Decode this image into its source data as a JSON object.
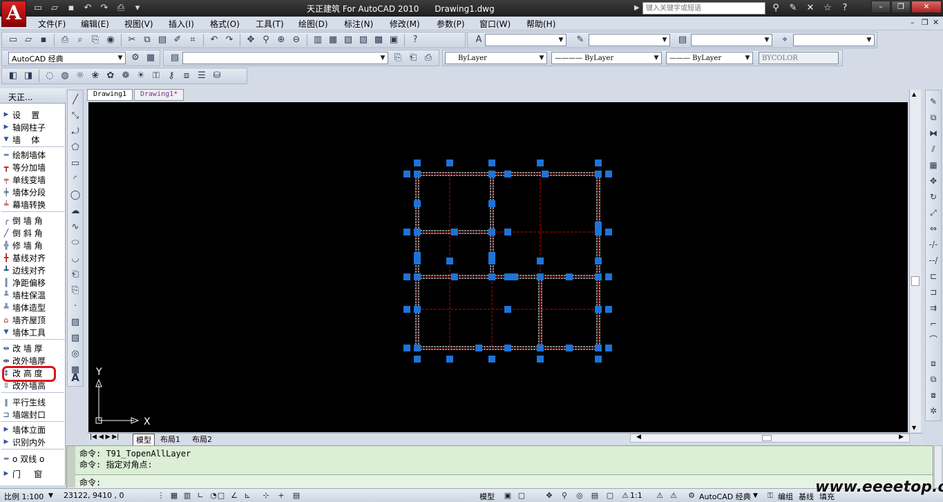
{
  "titlebar": {
    "logo": "A",
    "title": "天正建筑 For AutoCAD 2010      Drawing1.dwg",
    "search_placeholder": "键入关键字或短语",
    "window_buttons": [
      "–",
      "❐",
      "✕"
    ]
  },
  "menu": [
    "文件(F)",
    "编辑(E)",
    "视图(V)",
    "插入(I)",
    "格式(O)",
    "工具(T)",
    "绘图(D)",
    "标注(N)",
    "修改(M)",
    "参数(P)",
    "窗口(W)",
    "帮助(H)"
  ],
  "workspace": {
    "value": "AutoCAD 经典"
  },
  "properties": {
    "color": "ByLayer",
    "linetype": "———— ByLayer",
    "lineweight": "——— ByLayer",
    "plotstyle": "BYCOLOR"
  },
  "tz_panel": {
    "title": "天正...",
    "items": [
      {
        "label": "设    置",
        "icon": "tri"
      },
      {
        "label": "轴网柱子",
        "icon": "tri"
      },
      {
        "label": "墙    体",
        "icon": "tri-down"
      },
      {
        "label": "绘制墙体",
        "icon": "wall-draw-icon"
      },
      {
        "label": "等分加墙",
        "icon": "wall-divide-icon"
      },
      {
        "label": "单线变墙",
        "icon": "line-to-wall-icon"
      },
      {
        "label": "墙体分段",
        "icon": "wall-segment-icon"
      },
      {
        "label": "幕墙转换",
        "icon": "curtain-wall-icon"
      },
      {
        "label": "倒 墙 角",
        "icon": "wall-fillet-icon"
      },
      {
        "label": "倒 斜 角",
        "icon": "wall-chamfer-icon"
      },
      {
        "label": "修 墙 角",
        "icon": "wall-fix-icon"
      },
      {
        "label": "基线对齐",
        "icon": "baseline-align-icon"
      },
      {
        "label": "边线对齐",
        "icon": "edge-align-icon"
      },
      {
        "label": "净距偏移",
        "icon": "offset-icon"
      },
      {
        "label": "墙柱保温",
        "icon": "insulation-icon"
      },
      {
        "label": "墙体造型",
        "icon": "wall-shape-icon"
      },
      {
        "label": "墙齐屋顶",
        "icon": "wall-roof-icon"
      },
      {
        "label": "墙体工具",
        "icon": "tri-down"
      },
      {
        "label": "改 墙 厚",
        "icon": "thickness-icon"
      },
      {
        "label": "改外墙厚",
        "icon": "outer-thickness-icon"
      },
      {
        "label": "改 高 度",
        "icon": "height-icon"
      },
      {
        "label": "改外墙高",
        "icon": "outer-height-icon"
      },
      {
        "label": "平行生线",
        "icon": "parallel-line-icon"
      },
      {
        "label": "墙端封口",
        "icon": "end-seal-icon"
      },
      {
        "label": "墙体立面",
        "icon": "tri"
      },
      {
        "label": "识别内外",
        "icon": "tri"
      },
      {
        "label": "o 双线 o",
        "icon": "double-line-icon"
      },
      {
        "label": "门     窗",
        "icon": "tri"
      }
    ]
  },
  "tabs": [
    "Drawing1",
    "Drawing1*"
  ],
  "layout_tabs": [
    "模型",
    "布局1",
    "布局2"
  ],
  "ucs": {
    "x_label": "X",
    "y_label": "Y"
  },
  "command": {
    "history": [
      "命令: T91_TopenAllLayer",
      "命令: 指定对角点:"
    ],
    "prompt": "命令:"
  },
  "status": {
    "scale": "比例 1:100",
    "coords": "23122, 9410 , 0",
    "model": "模型",
    "annotation_scale": "1:1",
    "workspace": "AutoCAD 经典",
    "group": "编组",
    "baseline": "基线",
    "fill": "填充"
  },
  "watermark": "www.eeeetop.com",
  "colors": {
    "canvas": "#000000",
    "grip": "#1e73d6",
    "axis_line": "#c00000",
    "wall": "#ffffff",
    "highlight": "#e0101a"
  }
}
